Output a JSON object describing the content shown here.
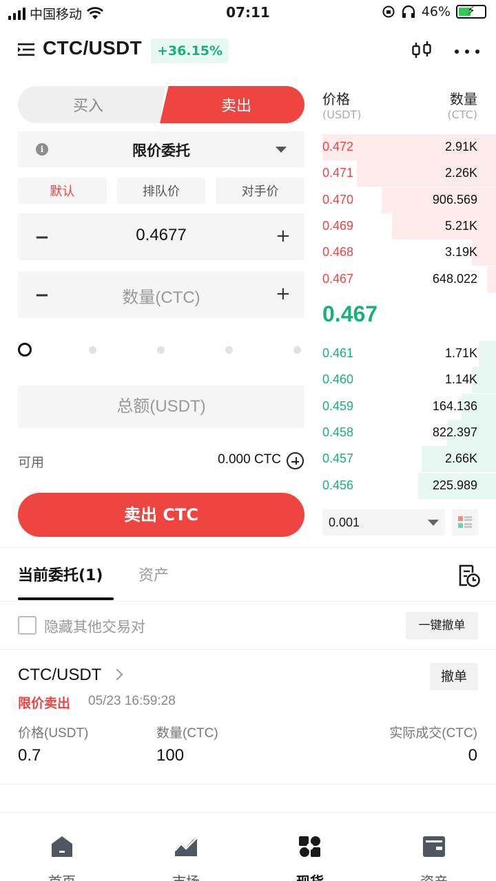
{
  "status_bar": {
    "carrier": "中国移动",
    "time": "07:11",
    "battery": "46%"
  },
  "header": {
    "pair": "CTC/USDT",
    "change": "+36.15%"
  },
  "trade": {
    "buy_tab": "买入",
    "sell_tab": "卖出",
    "order_type": "限价委托",
    "price_modes": [
      "默认",
      "排队价",
      "对手价"
    ],
    "price_value": "0.4677",
    "quantity_placeholder": "数量(CTC)",
    "total_placeholder": "总额(USDT)",
    "available_label": "可用",
    "available_value": "0.000 CTC",
    "submit_label": "卖出 CTC",
    "slider_percent": 0
  },
  "order_book": {
    "price_header": "价格",
    "qty_header": "数量",
    "price_unit": "(USDT)",
    "qty_unit": "(CTC)",
    "asks": [
      {
        "price": "0.472",
        "qty": "2.91K",
        "depth": 1.0
      },
      {
        "price": "0.471",
        "qty": "2.26K",
        "depth": 0.8
      },
      {
        "price": "0.470",
        "qty": "906.569",
        "depth": 0.66
      },
      {
        "price": "0.469",
        "qty": "5.21K",
        "depth": 0.6
      },
      {
        "price": "0.468",
        "qty": "3.19K",
        "depth": 0.14
      },
      {
        "price": "0.467",
        "qty": "648.022",
        "depth": 0.05
      }
    ],
    "last_price": "0.467",
    "bids": [
      {
        "price": "0.461",
        "qty": "1.71K",
        "depth": 0.1
      },
      {
        "price": "0.460",
        "qty": "1.14K",
        "depth": 0.14
      },
      {
        "price": "0.459",
        "qty": "164.136",
        "depth": 0.2
      },
      {
        "price": "0.458",
        "qty": "822.397",
        "depth": 0.28
      },
      {
        "price": "0.457",
        "qty": "2.66K",
        "depth": 0.43
      },
      {
        "price": "0.456",
        "qty": "225.989",
        "depth": 0.45
      }
    ],
    "precision": "0.001"
  },
  "orders": {
    "tab_current": "当前委托(1)",
    "tab_assets": "资产",
    "hide_others": "隐藏其他交易对",
    "cancel_all": "一键撤单",
    "item": {
      "pair": "CTC/USDT",
      "cancel": "撤单",
      "side": "限价卖出",
      "time": "05/23 16:59:28",
      "price_label": "价格(USDT)",
      "price": "0.7",
      "qty_label": "数量(CTC)",
      "qty": "100",
      "filled_label": "实际成交(CTC)",
      "filled": "0"
    }
  },
  "nav": {
    "home": "首页",
    "market": "市场",
    "spot": "现货",
    "assets": "资产"
  },
  "colors": {
    "sell": "#ee4540",
    "buy": "#17b27a"
  }
}
